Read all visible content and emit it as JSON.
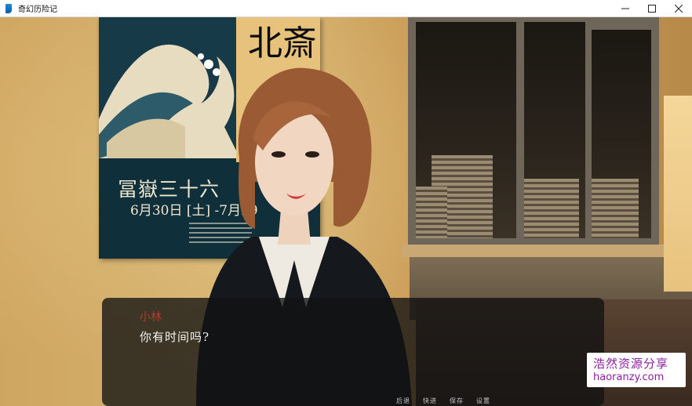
{
  "window": {
    "title": "奇幻历险记",
    "minimize_icon": "minimize-icon",
    "maximize_icon": "maximize-icon",
    "close_icon": "close-icon"
  },
  "poster": {
    "kanji_top": "北斎",
    "title": "冨嶽三十六",
    "date": "6月30日 [土] -7月29"
  },
  "dialogue": {
    "speaker": "小林",
    "text": "你有时间吗?"
  },
  "quick_menu": [
    "后退",
    "快进",
    "保存",
    "设置"
  ],
  "watermark": {
    "chinese": "浩然资源分享",
    "url": "haoranzy.com"
  },
  "colors": {
    "speaker": "#b43d2a",
    "dialogue_bg": "#121212",
    "watermark_text": "#8a1fa0"
  }
}
